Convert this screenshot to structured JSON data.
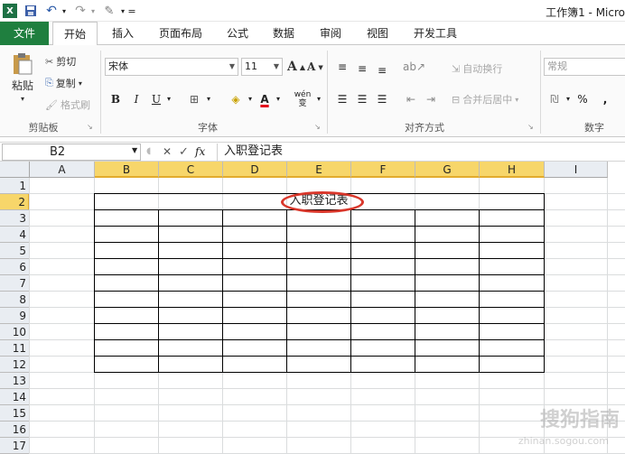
{
  "window": {
    "title": "工作簿1 - Micro",
    "app_icon": "excel-icon",
    "qat": {
      "save": "save-icon",
      "undo": "undo-icon",
      "redo": "redo-icon",
      "custom": "format-brush-icon",
      "more": "qat-dropdown-icon"
    }
  },
  "ribbon": {
    "tabs": [
      "文件",
      "开始",
      "插入",
      "页面布局",
      "公式",
      "数据",
      "审阅",
      "视图",
      "开发工具"
    ],
    "active_tab": "开始",
    "clipboard": {
      "paste": "粘贴",
      "cut": "剪切",
      "copy": "复制",
      "format_painter": "格式刷",
      "group": "剪贴板"
    },
    "font": {
      "name": "宋体",
      "size": "11",
      "grow": "A",
      "shrink": "A",
      "bold": "B",
      "italic": "I",
      "underline": "U",
      "wen": "wén",
      "wen_sub": "变",
      "group": "字体"
    },
    "alignment": {
      "wrap": "自动换行",
      "merge": "合并后居中",
      "group": "对齐方式"
    },
    "number": {
      "format": "常规",
      "percent": "%",
      "comma": ",",
      "group": "数字"
    }
  },
  "formula_bar": {
    "name_box": "B2",
    "cancel": "✕",
    "enter": "✓",
    "fx": "fx",
    "content": "入职登记表"
  },
  "sheet": {
    "columns": [
      "A",
      "B",
      "C",
      "D",
      "E",
      "F",
      "G",
      "H",
      "I"
    ],
    "rows": [
      "1",
      "2",
      "3",
      "4",
      "5",
      "6",
      "7",
      "8",
      "9",
      "10",
      "11",
      "12",
      "13",
      "14",
      "15",
      "16",
      "17"
    ],
    "selected_cell": "B2",
    "merged_title": "入职登记表"
  },
  "watermark": {
    "text": "搜狗指南",
    "url": "zhinan.sogou.com"
  },
  "colors": {
    "file_tab": "#1f7f3f",
    "selected_header": "#f7d66a",
    "annotation_oval": "#d9372b"
  }
}
